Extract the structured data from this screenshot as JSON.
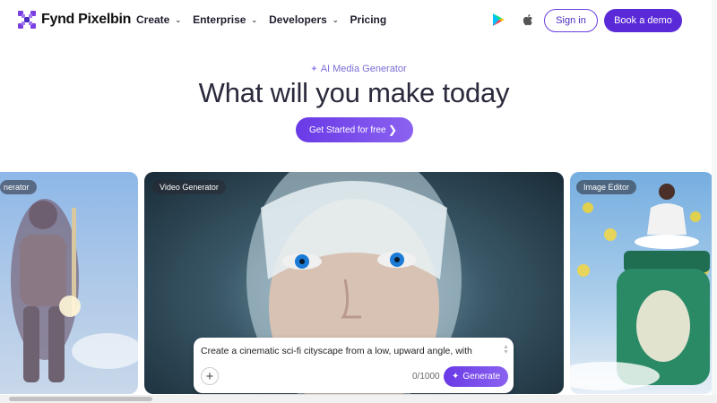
{
  "brand": {
    "name": "Fynd Pixelbin",
    "accent": "#5b2ad8"
  },
  "nav": {
    "items": [
      {
        "label": "Create",
        "has_dropdown": true
      },
      {
        "label": "Enterprise",
        "has_dropdown": true
      },
      {
        "label": "Developers",
        "has_dropdown": true
      },
      {
        "label": "Pricing",
        "has_dropdown": false
      }
    ],
    "store_icons": [
      "google-play-icon",
      "apple-icon"
    ],
    "signin_label": "Sign in",
    "demo_label": "Book a demo"
  },
  "hero": {
    "eyebrow": "AI Media Generator",
    "headline": "What will you make today",
    "cta_label": "Get Started for free"
  },
  "cards": [
    {
      "tag": "nerator"
    },
    {
      "tag": "Video Generator"
    },
    {
      "tag": "Image Editor"
    }
  ],
  "prompt": {
    "text": "Create a cinematic sci-fi cityscape from a low, upward angle, with",
    "counter": "0/1000",
    "generate_label": "Generate"
  }
}
